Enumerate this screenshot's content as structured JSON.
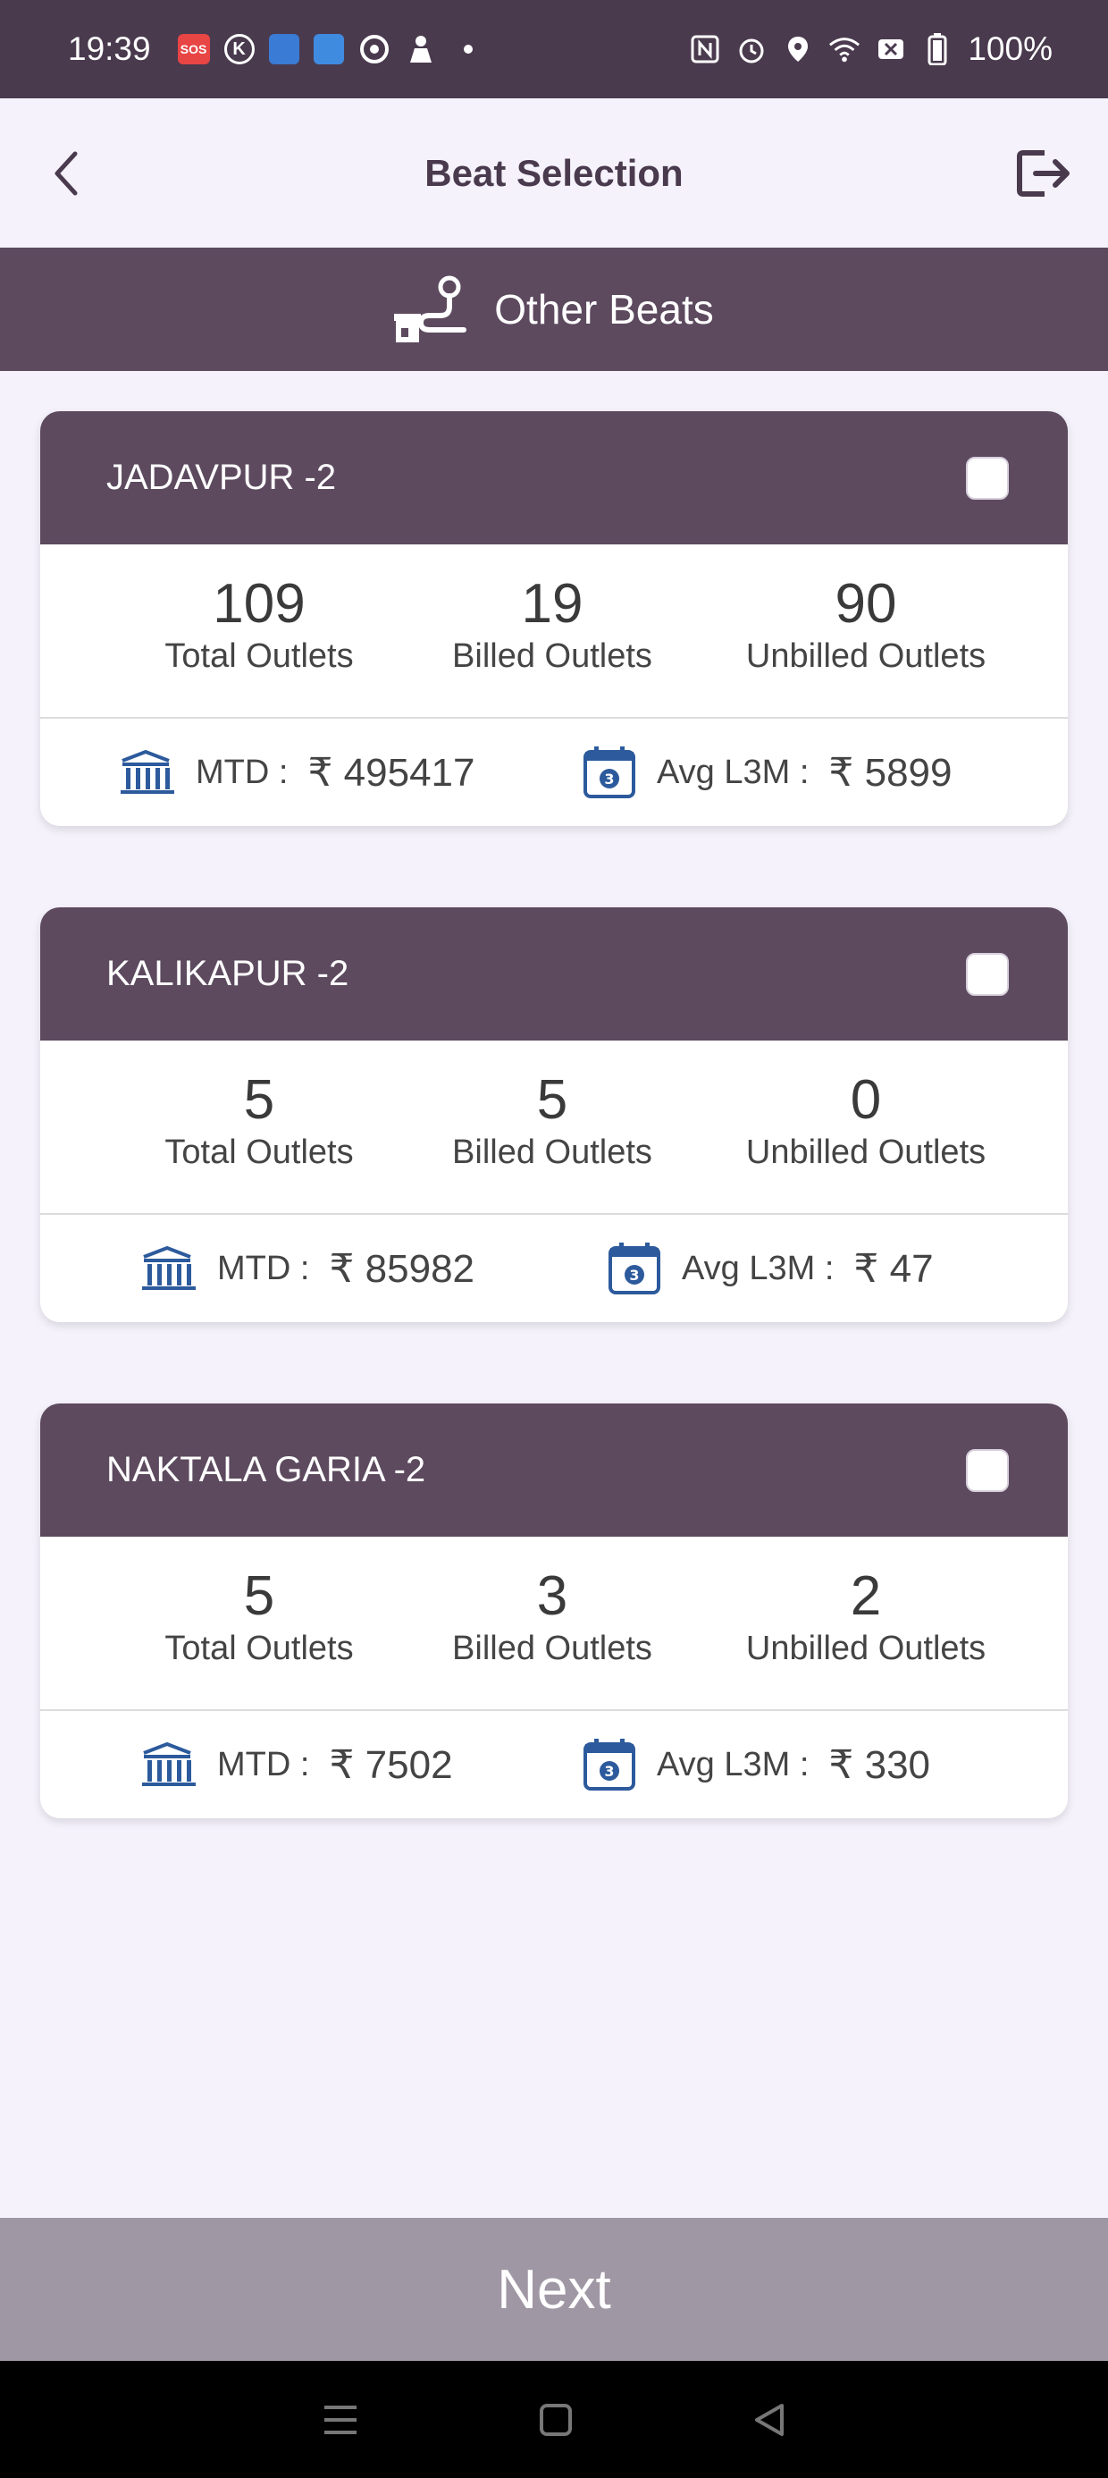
{
  "status_bar": {
    "time": "19:39",
    "sos_label": "SOS",
    "k_label": "K",
    "battery": "100%"
  },
  "header": {
    "title": "Beat Selection"
  },
  "section": {
    "title": "Other Beats"
  },
  "labels": {
    "total": "Total Outlets",
    "billed": "Billed Outlets",
    "unbilled": "Unbilled Outlets",
    "mtd": "MTD :",
    "avg": "Avg L3M :"
  },
  "beats": [
    {
      "name": "JADAVPUR -2",
      "checked": false,
      "total": "109",
      "billed": "19",
      "unbilled": "90",
      "mtd": "₹ 495417",
      "avg": "₹ 5899"
    },
    {
      "name": "KALIKAPUR -2",
      "checked": false,
      "total": "5",
      "billed": "5",
      "unbilled": "0",
      "mtd": "₹ 85982",
      "avg": "₹ 47"
    },
    {
      "name": "NAKTALA GARIA -2",
      "checked": false,
      "total": "5",
      "billed": "3",
      "unbilled": "2",
      "mtd": "₹ 7502",
      "avg": "₹ 330"
    }
  ],
  "footer": {
    "next_label": "Next"
  },
  "colors": {
    "status_bar": "#4a3a4e",
    "header_bg": "#f5f2fb",
    "card_header": "#5d4a5f",
    "icon_blue": "#2c5a9c",
    "next_bg": "#a097a4"
  }
}
